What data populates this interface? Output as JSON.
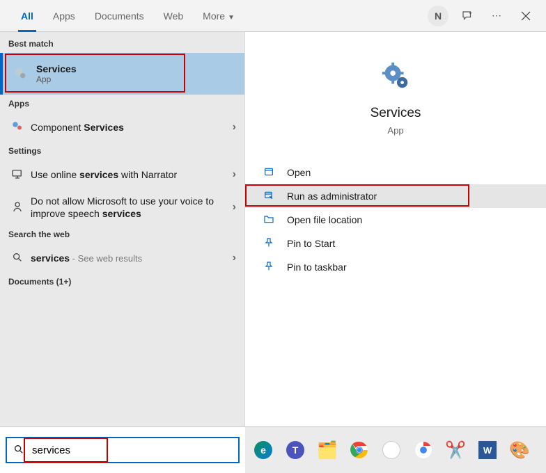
{
  "tabs": [
    "All",
    "Apps",
    "Documents",
    "Web",
    "More"
  ],
  "activeTab": 0,
  "avatar": "N",
  "left": {
    "bestMatchHeader": "Best match",
    "bestMatch": {
      "title": "Services",
      "subtitle": "App"
    },
    "appsHeader": "Apps",
    "appsItem": {
      "prefix": "Component ",
      "bold": "Services"
    },
    "settingsHeader": "Settings",
    "setting1": {
      "pre": "Use online ",
      "b": "services",
      "post": " with Narrator"
    },
    "setting2": {
      "pre": "Do not allow Microsoft to use your voice to improve speech ",
      "b": "services",
      "post": ""
    },
    "webHeader": "Search the web",
    "webItem": {
      "b": "services",
      "sub": " - See web results"
    },
    "documentsHeader": "Documents (1+)"
  },
  "preview": {
    "title": "Services",
    "subtitle": "App",
    "actions": [
      "Open",
      "Run as administrator",
      "Open file location",
      "Pin to Start",
      "Pin to taskbar"
    ]
  },
  "search": {
    "value": "services"
  }
}
